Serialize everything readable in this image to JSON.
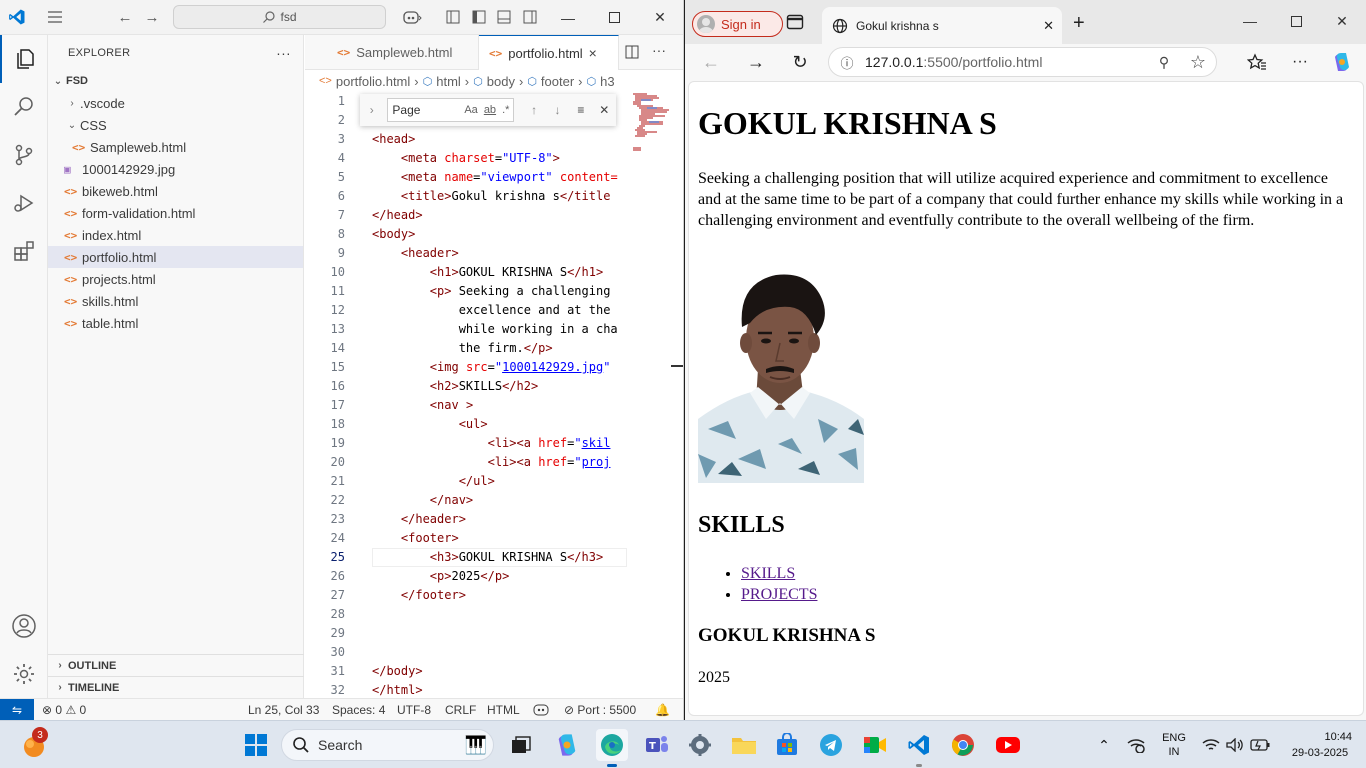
{
  "vscode": {
    "command_center": "fsd",
    "explorer": {
      "title": "EXPLORER",
      "more": "···",
      "root": "FSD",
      "items": [
        {
          "label": ".vscode",
          "kind": "folder",
          "indent": 1,
          "open": false
        },
        {
          "label": "CSS",
          "kind": "folder",
          "indent": 1,
          "open": true
        },
        {
          "label": "Sampleweb.html",
          "kind": "html",
          "indent": 2
        },
        {
          "label": "1000142929.jpg",
          "kind": "img",
          "indent": 1
        },
        {
          "label": "bikeweb.html",
          "kind": "html",
          "indent": 1
        },
        {
          "label": "form-validation.html",
          "kind": "html",
          "indent": 1
        },
        {
          "label": "index.html",
          "kind": "html",
          "indent": 1
        },
        {
          "label": "portfolio.html",
          "kind": "html",
          "indent": 1,
          "selected": true
        },
        {
          "label": "projects.html",
          "kind": "html",
          "indent": 1
        },
        {
          "label": "skills.html",
          "kind": "html",
          "indent": 1
        },
        {
          "label": "table.html",
          "kind": "html",
          "indent": 1
        }
      ],
      "outline": "OUTLINE",
      "timeline": "TIMELINE"
    },
    "tabs": [
      {
        "label": "Sampleweb.html",
        "active": false
      },
      {
        "label": "portfolio.html",
        "active": true,
        "close": "×"
      }
    ],
    "breadcrumb": [
      "portfolio.html",
      "html",
      "body",
      "footer",
      "h3"
    ],
    "find": {
      "placeholder": "Page",
      "opts": [
        "Aa",
        "ab",
        ".*"
      ]
    },
    "code_lines": [
      {
        "n": "1",
        "html": ""
      },
      {
        "n": "2",
        "html": ""
      },
      {
        "n": "3",
        "html": "<span class='t'>&lt;head&gt;</span>"
      },
      {
        "n": "4",
        "html": "    <span class='t'>&lt;meta</span> <span class='a'>charset</span><span class='x'>=</span><span class='s'>\"UTF-8\"</span><span class='t'>&gt;</span>"
      },
      {
        "n": "5",
        "html": "    <span class='t'>&lt;meta</span> <span class='a'>name</span><span class='x'>=</span><span class='s'>\"viewport\"</span> <span class='a'>content=</span>"
      },
      {
        "n": "6",
        "html": "    <span class='t'>&lt;title&gt;</span><span class='x'>Gokul krishna s</span><span class='t'>&lt;/title</span>"
      },
      {
        "n": "7",
        "html": "<span class='t'>&lt;/head&gt;</span>"
      },
      {
        "n": "8",
        "html": "<span class='t'>&lt;body&gt;</span>"
      },
      {
        "n": "9",
        "html": "    <span class='t'>&lt;header&gt;</span>"
      },
      {
        "n": "10",
        "html": "        <span class='t'>&lt;h1&gt;</span><span class='x'>GOKUL KRISHNA S</span><span class='t'>&lt;/h1&gt;</span>"
      },
      {
        "n": "11",
        "html": "        <span class='t'>&lt;p&gt;</span><span class='x'> Seeking a challenging</span>"
      },
      {
        "n": "12",
        "html": "<span class='x'>            excellence and at the</span>"
      },
      {
        "n": "13",
        "html": "<span class='x'>            while working in a cha</span>"
      },
      {
        "n": "14",
        "html": "<span class='x'>            the firm.</span><span class='t'>&lt;/p&gt;</span>"
      },
      {
        "n": "15",
        "html": "        <span class='t'>&lt;img</span> <span class='a'>src</span><span class='x'>=</span><span class='s'>\"</span><span class='u'>1000142929.jpg</span><span class='s'>\"</span>"
      },
      {
        "n": "16",
        "html": "        <span class='t'>&lt;h2&gt;</span><span class='x'>SKILLS</span><span class='t'>&lt;/h2&gt;</span>"
      },
      {
        "n": "17",
        "html": "        <span class='t'>&lt;nav</span> <span class='t'>&gt;</span>"
      },
      {
        "n": "18",
        "html": "            <span class='t'>&lt;ul&gt;</span>"
      },
      {
        "n": "19",
        "html": "                <span class='t'>&lt;li&gt;&lt;a</span> <span class='a'>href</span><span class='x'>=</span><span class='s'>\"</span><span class='u'>skil</span>"
      },
      {
        "n": "20",
        "html": "                <span class='t'>&lt;li&gt;&lt;a</span> <span class='a'>href</span><span class='x'>=</span><span class='s'>\"</span><span class='u'>proj</span>"
      },
      {
        "n": "21",
        "html": "            <span class='t'>&lt;/ul&gt;</span>"
      },
      {
        "n": "22",
        "html": "        <span class='t'>&lt;/nav&gt;</span>"
      },
      {
        "n": "23",
        "html": "    <span class='t'>&lt;/header&gt;</span>"
      },
      {
        "n": "24",
        "html": "    <span class='t'>&lt;footer&gt;</span>"
      },
      {
        "n": "25",
        "html": "        <span class='t'>&lt;h3&gt;</span><span class='x'>GOKUL KRISHNA S</span><span class='t'>&lt;/h3&gt;</span>"
      },
      {
        "n": "26",
        "html": "        <span class='t'>&lt;p&gt;</span><span class='x'>2025</span><span class='t'>&lt;/p&gt;</span>"
      },
      {
        "n": "27",
        "html": "    <span class='t'>&lt;/footer&gt;</span>"
      },
      {
        "n": "28",
        "html": ""
      },
      {
        "n": "29",
        "html": ""
      },
      {
        "n": "30",
        "html": ""
      },
      {
        "n": "31",
        "html": "<span class='t'>&lt;/body&gt;</span>"
      },
      {
        "n": "32",
        "html": "<span class='t'>&lt;/html&gt;</span>"
      }
    ],
    "current_line": "25",
    "status": {
      "errors": "0",
      "warnings": "0",
      "position": "Ln 25, Col 33",
      "spaces": "Spaces: 4",
      "encoding": "UTF-8",
      "eol": "CRLF",
      "language": "HTML",
      "port": "Port : 5500"
    }
  },
  "edge": {
    "sign_in": "Sign in",
    "tab_title": "Gokul krishna s",
    "url_host": "127.0.0.1",
    "url_path": ":5500/portfolio.html",
    "page": {
      "h1": "GOKUL KRISHNA S",
      "paragraph": "Seeking a challenging position that will utilize acquired experience and commitment to excellence and at the same time to be part of a company that could further enhance my skills while working in a challenging environment and eventfully contribute to the overall wellbeing of the firm.",
      "h2": "SKILLS",
      "links": [
        "SKILLS",
        "PROJECTS"
      ],
      "h3": "GOKUL KRISHNA S",
      "footer_year": "2025"
    }
  },
  "taskbar": {
    "search": "Search",
    "badge": "3",
    "lang_top": "ENG",
    "lang_bottom": "IN",
    "time": "10:44",
    "date": "29-03-2025"
  }
}
